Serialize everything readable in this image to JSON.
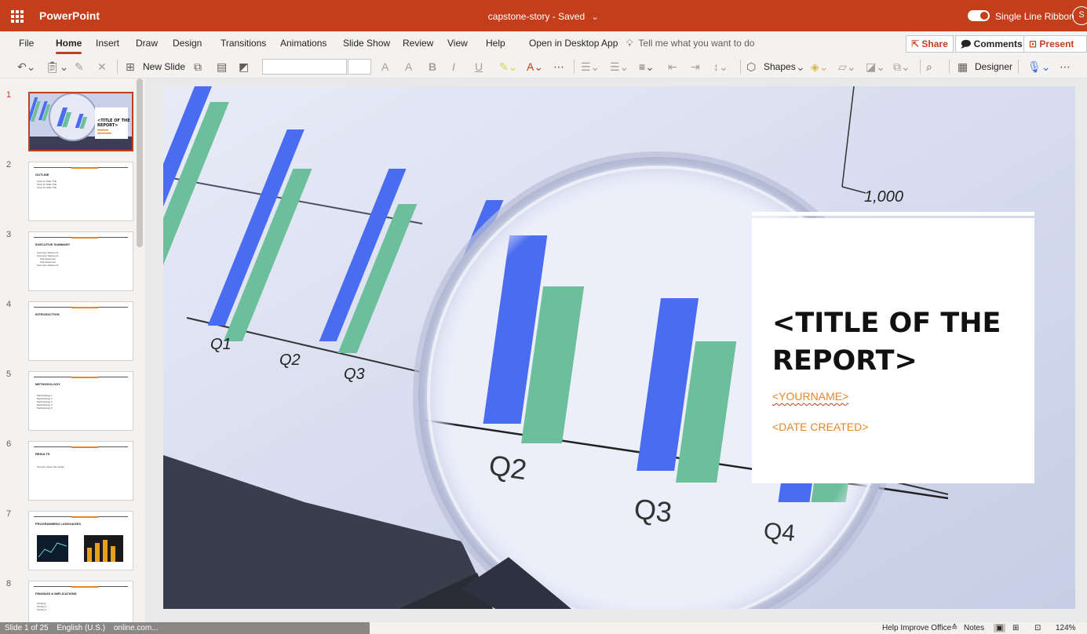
{
  "app": {
    "name": "PowerPoint",
    "doc_title": "capstone-story - Saved",
    "single_line_ribbon": "Single Line Ribbon",
    "user_initial": "S"
  },
  "menu": {
    "tabs": [
      "File",
      "Home",
      "Insert",
      "Draw",
      "Design",
      "Transitions",
      "Animations",
      "Slide Show",
      "Review",
      "View",
      "Help",
      "Open in Desktop App"
    ],
    "active_tab": "Home",
    "tell_me_placeholder": "Tell me what you want to do",
    "share": "Share",
    "comments": "Comments",
    "present": "Present"
  },
  "ribbon": {
    "new_slide": "New Slide",
    "shapes": "Shapes",
    "designer": "Designer",
    "font_name": "",
    "font_size": "",
    "more": "⋯"
  },
  "thumbnails": [
    {
      "num": "1",
      "title": "<TITLE OF THE REPORT>",
      "selected": true
    },
    {
      "num": "2",
      "title": "OUTLINE",
      "bullets": [
        "Topic for Slide Title",
        "Topic for Slide Title",
        "Topic for Slide Title"
      ]
    },
    {
      "num": "3",
      "title": "EXECUTIVE SUMMARY",
      "bullets": [
        "Summary Statement",
        "Summary Statement",
        "Sub-Statement",
        "Sub-Statement",
        "Summary Statement"
      ]
    },
    {
      "num": "4",
      "title": "INTRODUCTION",
      "bullets": []
    },
    {
      "num": "5",
      "title": "METHODOLOGY",
      "bullets": [
        "Methodology 1",
        "Methodology 2",
        "Methodology 3",
        "Methodology 4",
        "Methodology 5"
      ]
    },
    {
      "num": "6",
      "title": "RESULTS",
      "bullets": [
        "Tell story about the results"
      ]
    },
    {
      "num": "7",
      "title": "PROGRAMMING LANGUAGES",
      "bullets": []
    },
    {
      "num": "8",
      "title": "FINDINGS & IMPLICATIONS",
      "bullets": [
        "Findings",
        "Finding 1",
        "Finding 2"
      ]
    }
  ],
  "slide": {
    "title": "<TITLE OF THE REPORT>",
    "name": "<YOURNAME>",
    "date": "<DATE CREATED>",
    "photo_labels": {
      "q1": "Q1",
      "q2": "Q2",
      "q3": "Q3",
      "q4": "Q4",
      "axis_value": "1,000"
    }
  },
  "status": {
    "slide_count": "Slide 1 of 25",
    "language": "English (U.S.)",
    "url_fragment": "online.com...",
    "help_improve": "Help Improve Office",
    "notes": "Notes",
    "zoom": "124%"
  },
  "colors": {
    "brand": "#c43e1c",
    "accent_orange": "#e6862b",
    "bar_blue": "#4a6cf0",
    "bar_green": "#6bbf9a"
  }
}
